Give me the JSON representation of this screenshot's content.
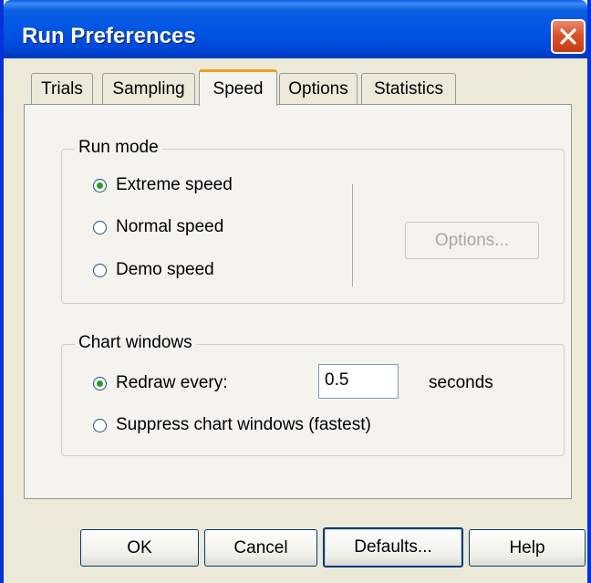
{
  "window": {
    "title": "Run Preferences"
  },
  "tabs": [
    {
      "label": "Trials",
      "active": false
    },
    {
      "label": "Sampling",
      "active": false
    },
    {
      "label": "Speed",
      "active": true
    },
    {
      "label": "Options",
      "active": false
    },
    {
      "label": "Statistics",
      "active": false
    }
  ],
  "run_mode": {
    "label": "Run mode",
    "options": [
      {
        "label": "Extreme speed",
        "checked": true
      },
      {
        "label": "Normal speed",
        "checked": false
      },
      {
        "label": "Demo speed",
        "checked": false
      }
    ],
    "options_button": {
      "label": "Options...",
      "enabled": false
    }
  },
  "chart_windows": {
    "label": "Chart windows",
    "redraw": {
      "label": "Redraw every:",
      "checked": true,
      "value": "0.5",
      "unit": "seconds"
    },
    "suppress": {
      "label": "Suppress chart windows (fastest)",
      "checked": false
    }
  },
  "buttons": {
    "ok": "OK",
    "cancel": "Cancel",
    "defaults": "Defaults...",
    "help": "Help"
  },
  "colors": {
    "titlebar": "#0055e5",
    "close_button": "#d9542c",
    "active_tab_highlight": "#f2a01e",
    "radio_dot": "#21a121",
    "dialog_bg": "#ece9d8"
  }
}
